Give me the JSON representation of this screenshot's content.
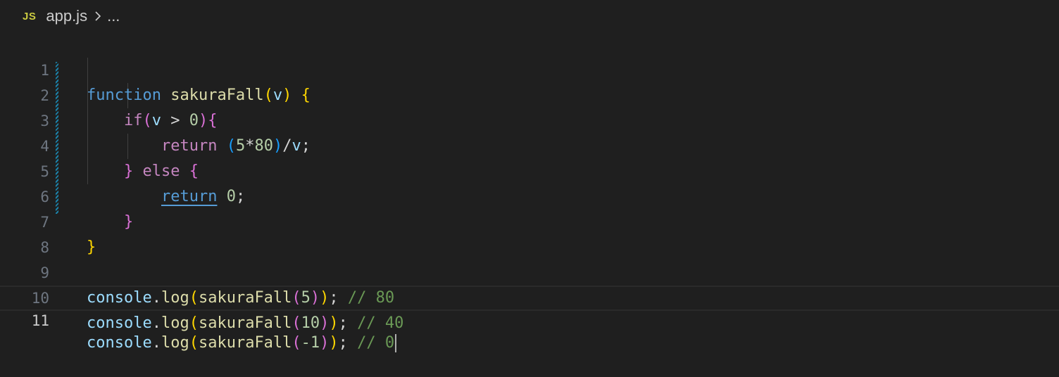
{
  "breadcrumb": {
    "language_badge": "JS",
    "file_name": "app.js",
    "ellipsis": "..."
  },
  "editor": {
    "line_numbers": [
      "1",
      "2",
      "3",
      "4",
      "5",
      "6",
      "7",
      "8",
      "9",
      "10",
      "11"
    ],
    "active_line": 11,
    "code": {
      "l1": {
        "kw": "function",
        "name": "sakuraFall",
        "open": "(",
        "param": "v",
        "close": ")",
        "brace": "{"
      },
      "l2": {
        "kw": "if",
        "open": "(",
        "v": "v",
        "op": " > ",
        "zero": "0",
        "close": ")",
        "brace": "{"
      },
      "l3": {
        "kw": "return",
        "open": "(",
        "n1": "5",
        "op": "*",
        "n2": "80",
        "close": ")",
        "div": "/",
        "v": "v",
        "semi": ";"
      },
      "l4": {
        "close_brace": "}",
        "kw": "else",
        "brace": "{"
      },
      "l5": {
        "kw": "return",
        "num": "0",
        "semi": ";"
      },
      "l6": {
        "brace": "}"
      },
      "l7": {
        "brace": "}"
      },
      "l9": {
        "obj": "console",
        "dot": ".",
        "method": "log",
        "open": "(",
        "fn": "sakuraFall",
        "open2": "(",
        "arg": "5",
        "close2": ")",
        "close": ")",
        "semi": ";",
        "comment": "// 80"
      },
      "l10": {
        "obj": "console",
        "dot": ".",
        "method": "log",
        "open": "(",
        "fn": "sakuraFall",
        "open2": "(",
        "arg": "10",
        "close2": ")",
        "close": ")",
        "semi": ";",
        "comment": "// 40"
      },
      "l11": {
        "obj": "console",
        "dot": ".",
        "method": "log",
        "open": "(",
        "fn": "sakuraFall",
        "open2": "(",
        "arg": "-1",
        "close2": ")",
        "close": ")",
        "semi": ";",
        "comment": "// 0"
      }
    }
  },
  "colors": {
    "background": "#1f1f1f",
    "keyword_blue": "#569cd6",
    "keyword_purple": "#c586c0",
    "function": "#dcdcaa",
    "variable": "#9cdcfe",
    "number": "#b5cea8",
    "comment": "#6a9955",
    "bracket_1": "#ffd700",
    "bracket_2": "#da70d6",
    "bracket_3": "#179fff",
    "modified_gutter": "#1b81a8"
  }
}
